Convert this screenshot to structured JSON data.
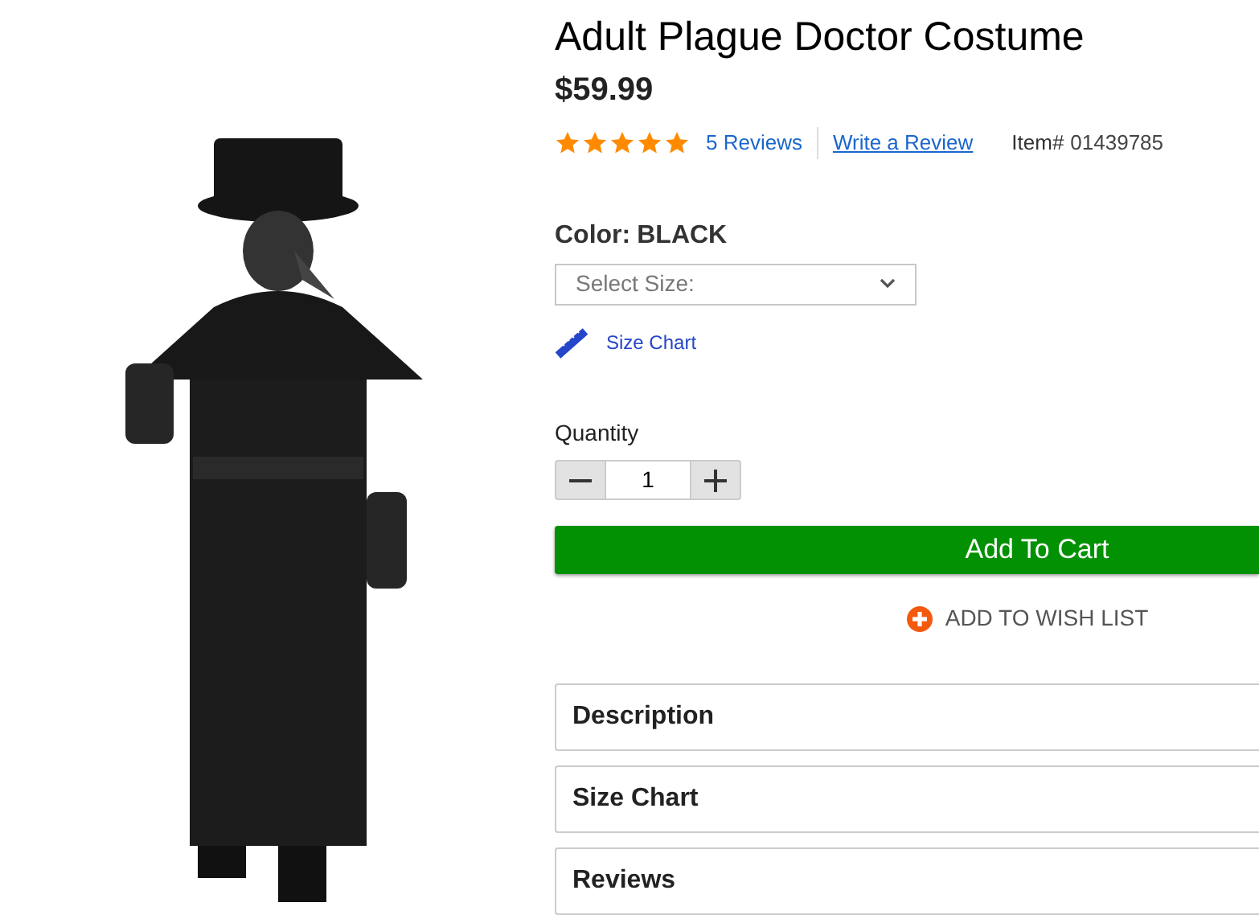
{
  "product": {
    "title": "Adult Plague Doctor Costume",
    "price": "$59.99",
    "stars": 5,
    "reviews_link": "5 Reviews",
    "write_review_link": "Write a Review",
    "item_label": "Item#",
    "item_number": "01439785"
  },
  "color": {
    "label": "Color:",
    "value": "BLACK"
  },
  "size_select": {
    "placeholder": "Select Size:"
  },
  "size_chart_link": "Size Chart",
  "quantity": {
    "label": "Quantity",
    "value": "1"
  },
  "add_to_cart": "Add To Cart",
  "wish_list": "ADD TO WISH LIST",
  "sections": [
    {
      "title": "Description"
    },
    {
      "title": "Size Chart"
    },
    {
      "title": "Reviews"
    }
  ]
}
